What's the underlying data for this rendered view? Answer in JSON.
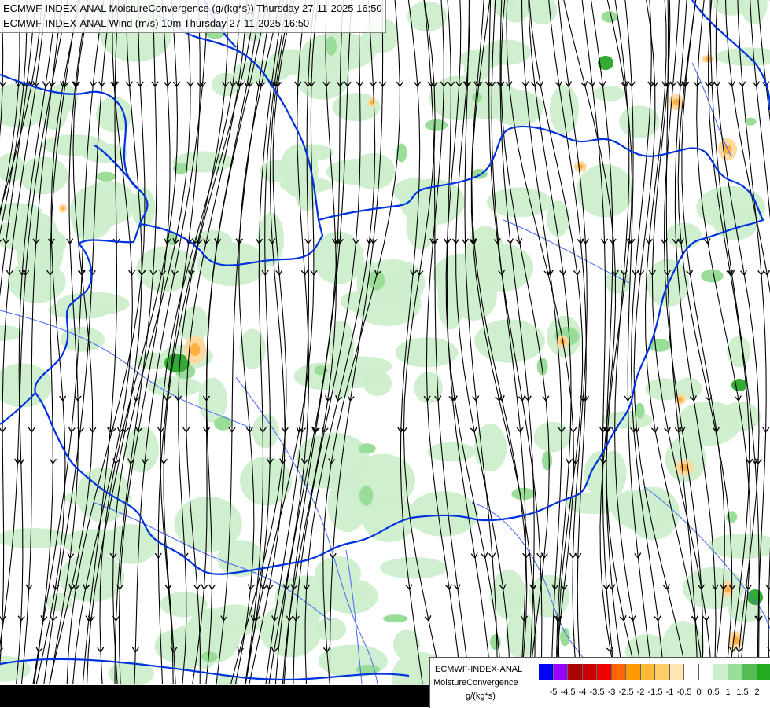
{
  "header": {
    "line1": "ECMWF-INDEX-ANAL MoistureConvergence (g/(kg*s)) Thursday 27-11-2025 16:50",
    "line2": "ECMWF-INDEX-ANAL Wind (m/s) 10m Thursday 27-11-2025 16:50"
  },
  "legend": {
    "model": "ECMWF-INDEX-ANAL",
    "parameter": "MoistureConvergence",
    "unit": "g/(kg*s)",
    "colors": [
      "#0000ff",
      "#9900ff",
      "#aa0000",
      "#cc0000",
      "#ee0000",
      "#ff6600",
      "#ff9900",
      "#ffbb33",
      "#ffcc66",
      "#ffe6b3",
      "#ffffff",
      "#ffffff",
      "#cceecc",
      "#99dd99",
      "#55bb55",
      "#22aa22"
    ],
    "tick_labels": [
      "-5",
      "-4.5",
      "-4",
      "-3.5",
      "-3",
      "-2.5",
      "-2",
      "-1.5",
      "-1",
      "-0.5",
      "0",
      "0.5",
      "1",
      "1.5",
      "2"
    ]
  },
  "map_style": {
    "border_color": "#0033dd",
    "river_color": "#4466ff",
    "streamline_color": "#000000",
    "convergence_light": "#cceecc",
    "convergence_mid": "#99dd99",
    "convergence_strong": "#33aa33",
    "divergence_light": "#ffd9a0",
    "divergence_mid": "#ffb040"
  }
}
